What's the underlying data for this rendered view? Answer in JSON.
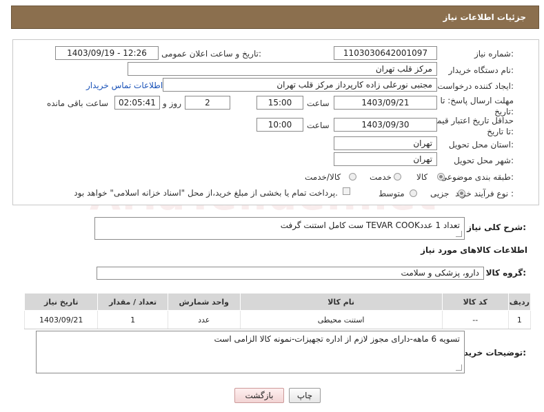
{
  "header": {
    "title": "جزئیات اطلاعات نیاز"
  },
  "form": {
    "need_number": {
      "label": "شماره نیاز:",
      "value": "1103030642001097"
    },
    "announce_datetime": {
      "label": "تاریخ و ساعت اعلان عمومی:",
      "value": "1403/09/19 - 12:26"
    },
    "buyer_org": {
      "label": "نام دستگاه خریدار:",
      "value": "مرکز قلب تهران"
    },
    "requester": {
      "label": "ایجاد کننده درخواست:",
      "value": "مجتبی نورعلی زاده کارپرداز مرکز قلب تهران"
    },
    "contact_link": "اطلاعات تماس خریدار",
    "reply_deadline": {
      "label": "مهلت ارسال پاسخ: تا تاریخ:",
      "date": "1403/09/21",
      "time_label": "ساعت",
      "time": "15:00",
      "days": "2",
      "days_label": "روز و",
      "remaining": "02:05:41",
      "remaining_label": "ساعت باقی مانده"
    },
    "price_validity": {
      "label": "حداقل تاریخ اعتبار قیمت: تا تاریخ:",
      "date": "1403/09/30",
      "time_label": "ساعت",
      "time": "10:00"
    },
    "delivery_province": {
      "label": "استان محل تحویل:",
      "value": "تهران"
    },
    "delivery_city": {
      "label": "شهر محل تحویل:",
      "value": "تهران"
    },
    "category": {
      "label": "طبقه بندی موضوعی:",
      "options": [
        "کالا",
        "خدمت",
        "کالا/خدمت"
      ],
      "selected": "کالا"
    },
    "process_type": {
      "label": "نوع فرآیند خرید :",
      "options": [
        "جزیی",
        "متوسط"
      ],
      "selected": "جزیی",
      "payment_note": "پرداخت تمام یا بخشی از مبلغ خرید،از محل \"اسناد خزانه اسلامی\" خواهد بود."
    }
  },
  "description": {
    "label": "شرح کلی نیاز:",
    "value": "ست کامل استنت گرفت TEVAR COOKتعداد 1 عدد"
  },
  "goods_info": {
    "title": "اطلاعات کالاهای مورد نیاز",
    "group_label": "گروه کالا:",
    "group_value": "دارو، پزشکی و سلامت",
    "table": {
      "headers": [
        "ردیف",
        "کد کالا",
        "نام کالا",
        "واحد شمارش",
        "تعداد / مقدار",
        "تاریخ نیاز"
      ],
      "rows": [
        [
          "1",
          "--",
          "استنت محیطی",
          "عدد",
          "1",
          "1403/09/21"
        ]
      ]
    }
  },
  "buyer_notes": {
    "label": "توضیحات خریدار:",
    "value": "تسویه 6 ماهه-دارای مجوز لازم از اداره تجهیزات-نمونه کالا الزامی است"
  },
  "buttons": {
    "print": "چاپ",
    "back": "بازگشت"
  },
  "watermark": "AriaTender.net",
  "colors": {
    "header_bg": "#8b6f4e",
    "link": "#1a52b8"
  }
}
